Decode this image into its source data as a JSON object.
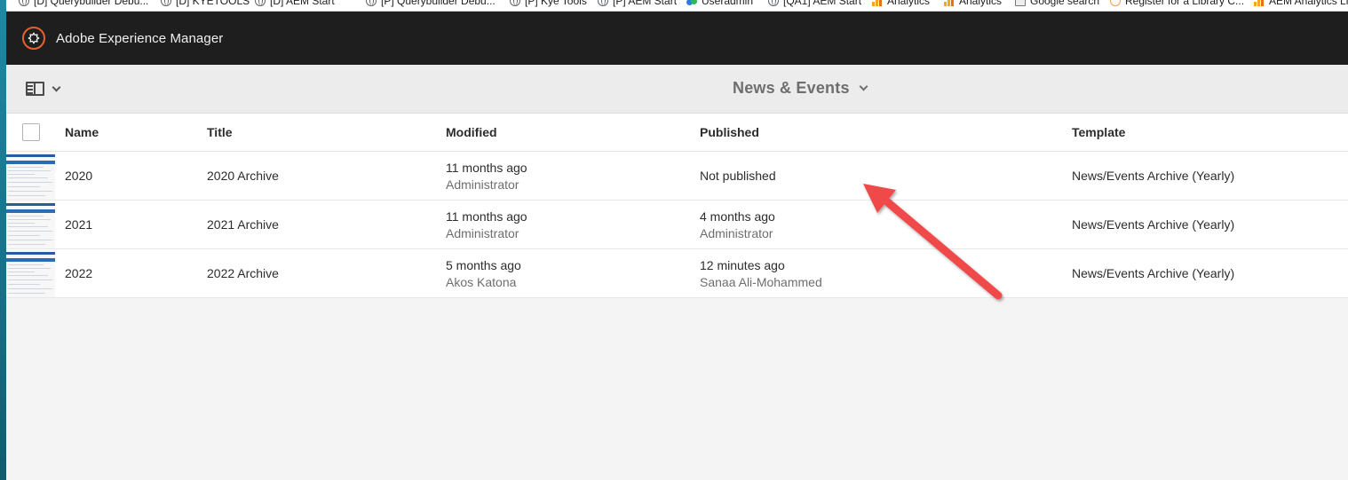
{
  "bookmarks": [
    {
      "label": "[D] Querybuilder Debu...",
      "icon": "globe-icon"
    },
    {
      "label": "[D] KYETOOLS",
      "icon": "globe-icon"
    },
    {
      "label": "[D] AEM Start",
      "icon": "globe-icon"
    },
    {
      "label": "[P] Querybuilder Debu...",
      "icon": "globe-icon"
    },
    {
      "label": "[P] Kye Tools",
      "icon": "globe-icon"
    },
    {
      "label": "[P] AEM Start",
      "icon": "globe-icon"
    },
    {
      "label": "Useradmin",
      "icon": "users-icon"
    },
    {
      "label": "[QA1] AEM Start",
      "icon": "globe-icon"
    },
    {
      "label": "Analytics",
      "icon": "analytics-icon"
    },
    {
      "label": "Analytics",
      "icon": "analytics-icon"
    },
    {
      "label": "Google search",
      "icon": "document-icon"
    },
    {
      "label": "Register for a Library C...",
      "icon": "register-icon"
    },
    {
      "label": "AEM Analytics Live",
      "icon": "analytics-icon"
    }
  ],
  "header": {
    "app_name": "Adobe Experience Manager",
    "brand_color": "#e8612c"
  },
  "action_bar": {
    "title": "News & Events"
  },
  "table": {
    "columns": {
      "name": "Name",
      "title": "Title",
      "modified": "Modified",
      "published": "Published",
      "template": "Template"
    },
    "rows": [
      {
        "name": "2020",
        "title": "2020 Archive",
        "modified": {
          "time": "11 months ago",
          "by": "Administrator"
        },
        "published": {
          "status": "Not published"
        },
        "template": "News/Events Archive (Yearly)"
      },
      {
        "name": "2021",
        "title": "2021 Archive",
        "modified": {
          "time": "11 months ago",
          "by": "Administrator"
        },
        "published": {
          "time": "4 months ago",
          "by": "Administrator"
        },
        "template": "News/Events Archive (Yearly)"
      },
      {
        "name": "2022",
        "title": "2022 Archive",
        "modified": {
          "time": "5 months ago",
          "by": "Akos Katona"
        },
        "published": {
          "time": "12 minutes ago",
          "by": "Sanaa Ali-Mohammed"
        },
        "template": "News/Events Archive (Yearly)"
      }
    ]
  },
  "annotation_color": "#f04a4a"
}
